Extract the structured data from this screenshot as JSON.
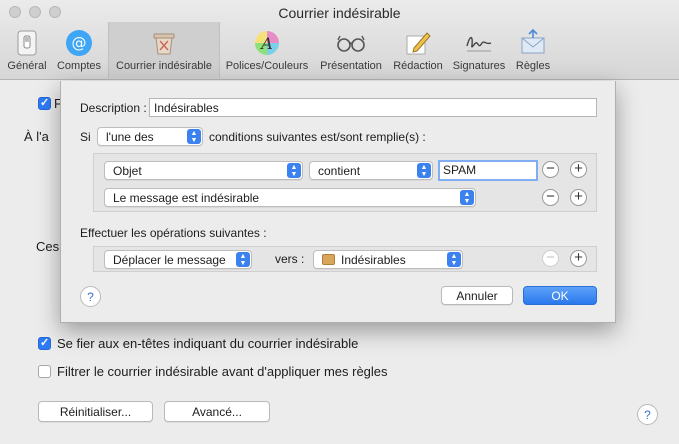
{
  "window": {
    "title": "Courrier indésirable"
  },
  "toolbar": {
    "items": [
      {
        "label": "Général",
        "icon": "switch-icon"
      },
      {
        "label": "Comptes",
        "icon": "at-icon"
      },
      {
        "label": "Courrier indésirable",
        "icon": "junk-bin-icon",
        "selected": true
      },
      {
        "label": "Polices/Couleurs",
        "icon": "fonts-colors-icon"
      },
      {
        "label": "Présentation",
        "icon": "glasses-icon"
      },
      {
        "label": "Rédaction",
        "icon": "pencil-icon"
      },
      {
        "label": "Signatures",
        "icon": "signature-icon"
      },
      {
        "label": "Règles",
        "icon": "rules-icon"
      }
    ]
  },
  "pane": {
    "partial_texts": [
      "À l'a",
      "Ces"
    ],
    "trust_headers_label": "Se fier aux en-têtes indiquant du courrier indésirable",
    "trust_headers_checked": true,
    "filter_before_rules_label": "Filtrer le courrier indésirable avant d'appliquer mes règles",
    "filter_before_rules_checked": false,
    "reset_button": "Réinitialiser...",
    "advanced_button": "Avancé...",
    "help": "?"
  },
  "sheet": {
    "description_label": "Description :",
    "description_value": "Indésirables",
    "if_label": "Si",
    "match_select": "l'une des",
    "conditions_label": "conditions suivantes est/sont remplie(s) :",
    "conditions": [
      {
        "field": "Objet",
        "operator": "contient",
        "value": "SPAM"
      },
      {
        "field": "Le message est indésirable"
      }
    ],
    "actions_label": "Effectuer les opérations suivantes :",
    "action": {
      "operation": "Déplacer le message",
      "vers_label": "vers :",
      "destination": "Indésirables"
    },
    "help": "?",
    "cancel_button": "Annuler",
    "ok_button": "OK"
  },
  "colors": {
    "accent": "#2f7bf5",
    "window_bg": "#ececec"
  }
}
